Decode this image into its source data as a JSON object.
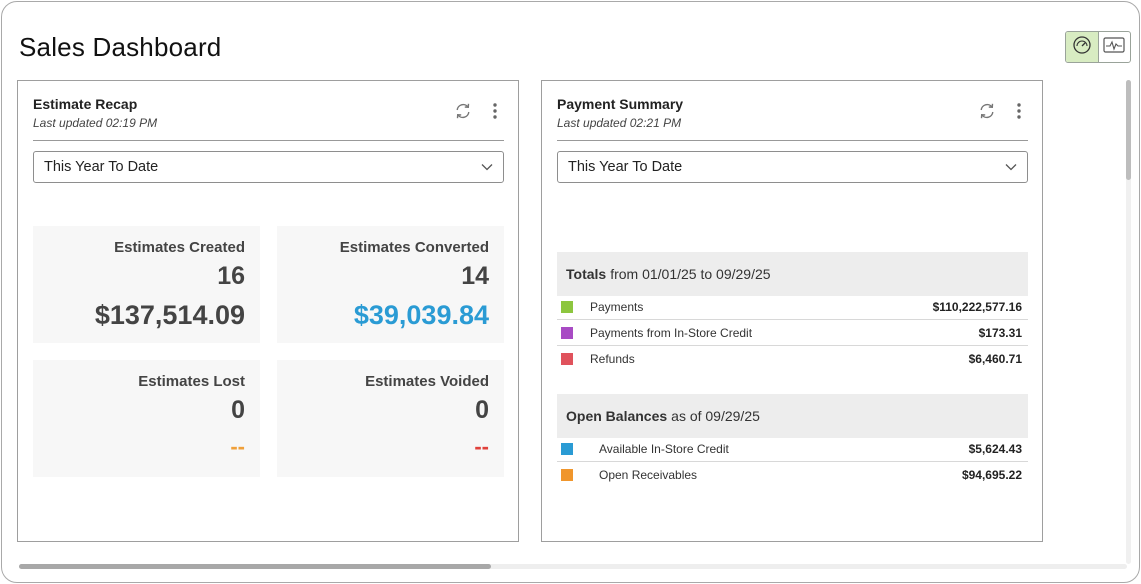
{
  "page": {
    "title": "Sales Dashboard"
  },
  "view_toggle": [
    {
      "icon": "dashboard-gauge-icon",
      "active": true
    },
    {
      "icon": "activity-chart-icon",
      "active": false
    }
  ],
  "estimate_recap": {
    "title": "Estimate Recap",
    "last_updated": "Last updated 02:19 PM",
    "range": "This Year To Date",
    "tiles": [
      {
        "label": "Estimates Created",
        "count": "16",
        "amount": "$137,514.09",
        "amount_color": "#444444"
      },
      {
        "label": "Estimates Converted",
        "count": "14",
        "amount": "$39,039.84",
        "amount_color": "#2a9bd4"
      },
      {
        "label": "Estimates Lost",
        "count": "0",
        "amount": "--",
        "amount_color": "#f0a03a"
      },
      {
        "label": "Estimates Voided",
        "count": "0",
        "amount": "--",
        "amount_color": "#e0413b"
      }
    ]
  },
  "payment_summary": {
    "title": "Payment Summary",
    "last_updated": "Last updated 02:21 PM",
    "range": "This Year To Date",
    "totals": {
      "heading": "Totals",
      "period": "from 01/01/25 to 09/29/25",
      "rows": [
        {
          "label": "Payments",
          "value": "$110,222,577.16",
          "color": "#8dc63f"
        },
        {
          "label": "Payments from In-Store Credit",
          "value": "$173.31",
          "color": "#a84bc4"
        },
        {
          "label": "Refunds",
          "value": "$6,460.71",
          "color": "#e0525c"
        }
      ]
    },
    "open_balances": {
      "heading": "Open Balances",
      "period": "as of 09/29/25",
      "rows": [
        {
          "label": "Available In-Store Credit",
          "value": "$5,624.43",
          "color": "#2a9bd4"
        },
        {
          "label": "Open Receivables",
          "value": "$94,695.22",
          "color": "#f0962c"
        }
      ]
    }
  }
}
